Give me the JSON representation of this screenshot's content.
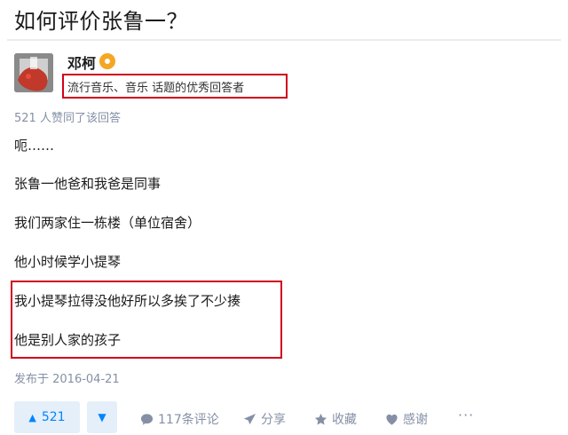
{
  "question": {
    "title": "如何评价张鲁一？"
  },
  "author": {
    "name": "邓柯",
    "bio": "流行音乐、音乐 话题的优秀回答者",
    "badge_icon": "gold-badge-icon"
  },
  "answer": {
    "vote_summary": "521 人赞同了该回答",
    "paragraphs": [
      "呃……",
      "张鲁一他爸和我爸是同事",
      "我们两家住一栋楼（单位宿舍）",
      "他小时候学小提琴",
      "我小提琴拉得没他好所以多挨了不少揍",
      "他是别人家的孩子"
    ],
    "published": "发布于 2016-04-21"
  },
  "actions": {
    "upvote_count": "521",
    "upvote_arrow": "▲",
    "downvote_arrow": "▼",
    "comments": "117条评论",
    "share": "分享",
    "favorite": "收藏",
    "thanks": "感谢",
    "more": "···"
  },
  "colors": {
    "accent": "#0084ff",
    "annotation_red": "#d0021b",
    "meta_gray": "#8590a6"
  }
}
